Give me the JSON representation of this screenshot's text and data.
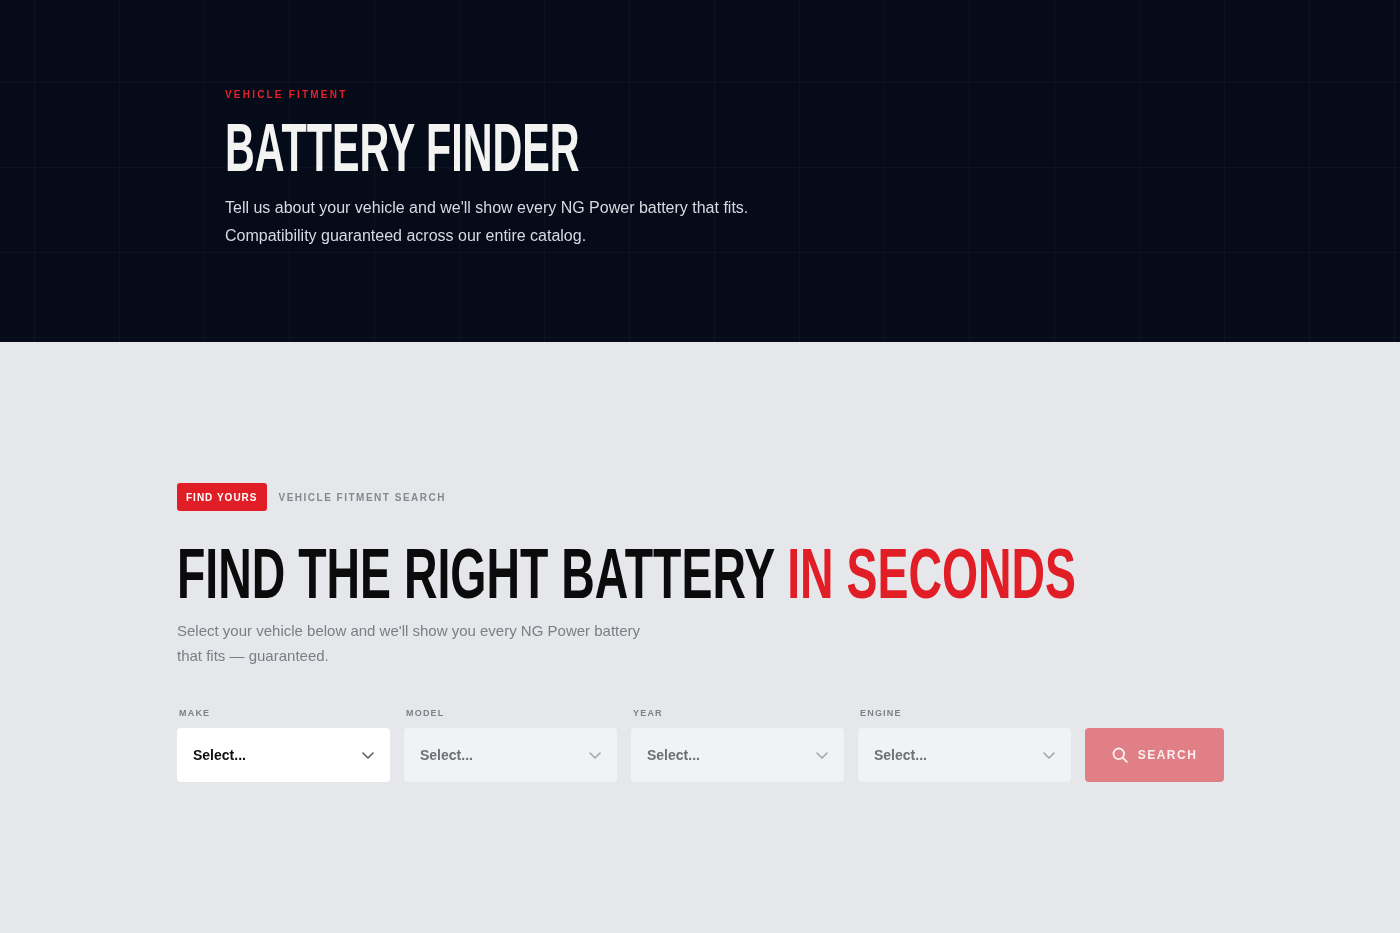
{
  "hero": {
    "eyebrow": "VEHICLE FITMENT",
    "title": "BATTERY FINDER",
    "description": "Tell us about your vehicle and we'll show every NG Power battery that fits. Compatibility guaranteed across our entire catalog."
  },
  "finder": {
    "badge": "FIND YOURS",
    "eyebrow": "VEHICLE FITMENT SEARCH",
    "heading": {
      "text": "FIND THE RIGHT BATTERY",
      "accent": "IN SECONDS"
    },
    "description": "Select your vehicle below and we'll show you every NG Power battery that fits — guaranteed.",
    "fields": [
      {
        "label": "MAKE",
        "placeholder": "Select...",
        "disabled": false
      },
      {
        "label": "MODEL",
        "placeholder": "Select...",
        "disabled": true
      },
      {
        "label": "YEAR",
        "placeholder": "Select...",
        "disabled": true
      },
      {
        "label": "ENGINE",
        "placeholder": "Select...",
        "disabled": true
      }
    ],
    "search_button": {
      "label": "SEARCH",
      "disabled": true
    }
  }
}
